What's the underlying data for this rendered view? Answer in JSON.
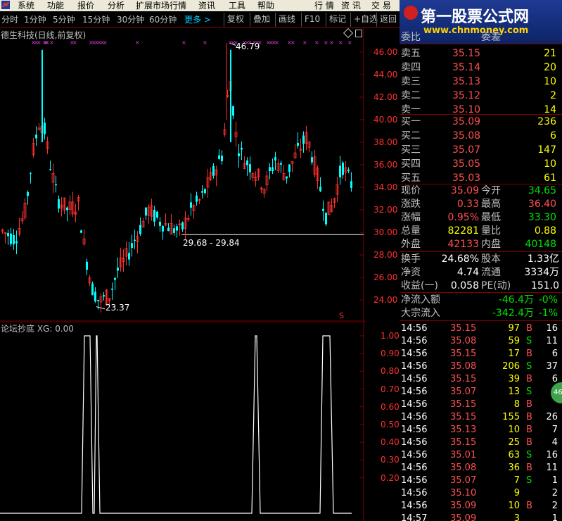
{
  "menu": {
    "items": [
      "系统",
      "功能",
      "报价",
      "分析",
      "扩展市场行情",
      "资讯",
      "工具",
      "帮助"
    ],
    "right": [
      "行 情",
      "资 讯",
      "交 易"
    ]
  },
  "toolbar": {
    "periods": [
      "分时",
      "1分钟",
      "5分钟",
      "15分钟",
      "30分钟",
      "60分钟"
    ],
    "more": "更多 >",
    "buttons": [
      "复权",
      "叠加",
      "画线",
      "F10",
      "标记",
      "+自选",
      "返回"
    ]
  },
  "watermark": {
    "line1": "第一股票公式网",
    "line2": "www.chnmoney.com"
  },
  "kchart": {
    "title": "德生科技(日线,前复权)",
    "high_label": "46.79",
    "low_label": "23.37",
    "range_label": "29.68 - 29.84",
    "y_ticks": [
      "46.00",
      "44.00",
      "42.00",
      "40.00",
      "38.00",
      "36.00",
      "34.00",
      "32.00",
      "30.00",
      "28.00",
      "26.00",
      "24.00"
    ],
    "marker": "S"
  },
  "indicator": {
    "title": "论坛抄底 XG: 0.00",
    "y_ticks": [
      "1.00",
      "0.90",
      "0.80",
      "0.70",
      "0.60",
      "0.50",
      "0.40",
      "0.30",
      "0.20"
    ]
  },
  "colors": {
    "up": "#ff3030",
    "down": "#00ffff",
    "frame": "#800000",
    "accent": "#00d0ff"
  },
  "quote": {
    "sell_top_cut": {
      "left": "委比",
      "right": "委差"
    },
    "asks": [
      {
        "label": "卖五",
        "price": "35.15",
        "vol": "21"
      },
      {
        "label": "卖四",
        "price": "35.14",
        "vol": "20"
      },
      {
        "label": "卖三",
        "price": "35.13",
        "vol": "10"
      },
      {
        "label": "卖二",
        "price": "35.12",
        "vol": "2"
      },
      {
        "label": "卖一",
        "price": "35.10",
        "vol": "14"
      }
    ],
    "bids": [
      {
        "label": "买一",
        "price": "35.09",
        "vol": "236"
      },
      {
        "label": "买二",
        "price": "35.08",
        "vol": "6"
      },
      {
        "label": "买三",
        "price": "35.07",
        "vol": "147"
      },
      {
        "label": "买四",
        "price": "35.05",
        "vol": "10"
      },
      {
        "label": "买五",
        "price": "35.03",
        "vol": "61"
      }
    ],
    "stats": [
      {
        "l1": "现价",
        "v1": "35.09",
        "c1": "red",
        "l2": "今开",
        "v2": "34.65",
        "c2": "grn"
      },
      {
        "l1": "涨跌",
        "v1": "0.33",
        "c1": "red",
        "l2": "最高",
        "v2": "36.40",
        "c2": "red"
      },
      {
        "l1": "涨幅",
        "v1": "0.95%",
        "c1": "red",
        "l2": "最低",
        "v2": "33.30",
        "c2": "grn"
      },
      {
        "l1": "总量",
        "v1": "82281",
        "c1": "yel",
        "l2": "量比",
        "v2": "0.88",
        "c2": "yel"
      },
      {
        "l1": "外盘",
        "v1": "42133",
        "c1": "red",
        "l2": "内盘",
        "v2": "40148",
        "c2": "grn"
      }
    ],
    "fund": [
      {
        "l1": "换手",
        "v1": "24.68%",
        "l2": "股本",
        "v2": "1.33亿"
      },
      {
        "l1": "净资",
        "v1": "4.74",
        "l2": "流通",
        "v2": "3334万"
      },
      {
        "l1": "收益(一)",
        "v1": "0.058",
        "l2": "PE(动)",
        "v2": "151.0"
      }
    ],
    "flow": [
      {
        "l": "净流入额",
        "v": "-46.4万",
        "p": "-0%"
      },
      {
        "l": "大宗流入",
        "v": "-342.4万",
        "p": "-1%"
      }
    ]
  },
  "trades": [
    {
      "t": "14:56",
      "p": "35.15",
      "v": "97",
      "s": "B",
      "n": "16"
    },
    {
      "t": "14:56",
      "p": "35.08",
      "v": "59",
      "s": "S",
      "n": "11"
    },
    {
      "t": "14:56",
      "p": "35.15",
      "v": "17",
      "s": "B",
      "n": "6"
    },
    {
      "t": "14:56",
      "p": "35.08",
      "v": "206",
      "s": "S",
      "n": "37"
    },
    {
      "t": "14:56",
      "p": "35.15",
      "v": "39",
      "s": "B",
      "n": "6"
    },
    {
      "t": "14:56",
      "p": "35.07",
      "v": "13",
      "s": "S",
      "n": ""
    },
    {
      "t": "14:56",
      "p": "35.15",
      "v": "8",
      "s": "B",
      "n": ""
    },
    {
      "t": "14:56",
      "p": "35.15",
      "v": "155",
      "s": "B",
      "n": "26"
    },
    {
      "t": "14:56",
      "p": "35.13",
      "v": "10",
      "s": "B",
      "n": "7"
    },
    {
      "t": "14:56",
      "p": "35.15",
      "v": "25",
      "s": "B",
      "n": "4"
    },
    {
      "t": "14:56",
      "p": "35.01",
      "v": "63",
      "s": "S",
      "n": "16"
    },
    {
      "t": "14:56",
      "p": "35.08",
      "v": "36",
      "s": "B",
      "n": "11"
    },
    {
      "t": "14:56",
      "p": "35.07",
      "v": "7",
      "s": "S",
      "n": "1"
    },
    {
      "t": "14:56",
      "p": "35.10",
      "v": "9",
      "s": "",
      "n": "2"
    },
    {
      "t": "14:56",
      "p": "35.09",
      "v": "10",
      "s": "B",
      "n": "2"
    },
    {
      "t": "14:57",
      "p": "35.09",
      "v": "3",
      "s": "",
      "n": "1"
    }
  ],
  "bubble": "46"
}
